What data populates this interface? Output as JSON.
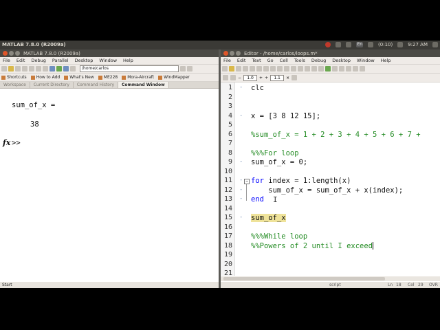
{
  "system": {
    "title": "MATLAB  7.8.0 (R2009a)",
    "tray_en": "En",
    "battery": "(0:10)",
    "time": "9:27 AM"
  },
  "matlab": {
    "title": "MATLAB  7.8.0 (R2009a)",
    "menu": [
      "File",
      "Edit",
      "Debug",
      "Parallel",
      "Desktop",
      "Window",
      "Help"
    ],
    "current_folder": "/home/carlos",
    "shortcuts": [
      "Shortcuts",
      "How to Add",
      "What's New",
      "ME228",
      "Mora-Aircraft",
      "WindMapper"
    ],
    "tabs": [
      "Workspace",
      "Current Directory",
      "Command History",
      "Command Window"
    ],
    "console": {
      "output_line1": "sum_of_x =",
      "output_line2": "38",
      "fx": "fx",
      "prompt": ">>"
    },
    "status": "Start"
  },
  "editor": {
    "title": "Editor - /home/carlos/loops.m*",
    "menu": [
      "File",
      "Edit",
      "Text",
      "Go",
      "Cell",
      "Tools",
      "Debug",
      "Desktop",
      "Window",
      "Help"
    ],
    "cell_value1": "1.0",
    "cell_value2": "1.1",
    "line_numbers": [
      "1",
      "2",
      "3",
      "4",
      "5",
      "6",
      "7",
      "8",
      "9",
      "10",
      "11",
      "12",
      "13",
      "14",
      "15",
      "16",
      "17",
      "18",
      "19",
      "20",
      "21"
    ],
    "code": {
      "l1": "clc",
      "l4": "x = [3 8 12 15];",
      "l6": "%sum_of_x = 1 + 2 + 3 + 4 + 5 + 6 + 7 +",
      "l8": "%%%For loop",
      "l9": "sum_of_x = 0;",
      "l11_kw": "for",
      "l11_rest": " index = 1:length(x)",
      "l12": "    sum_of_x = sum_of_x + x(index);",
      "l13_kw": "end",
      "l13_cursor": "I",
      "l15": "sum_of_x",
      "l17": "%%%While loop",
      "l18": "%%Powers of 2 until I exceed"
    },
    "status": {
      "mode": "script",
      "ln_label": "Ln",
      "ln": "18",
      "col_label": "Col",
      "col": "29",
      "ovr": "OVR"
    }
  }
}
